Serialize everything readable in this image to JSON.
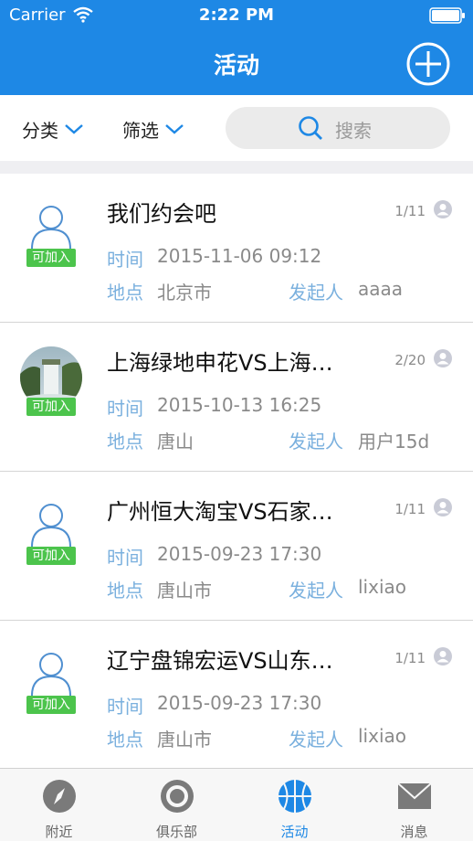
{
  "status_bar": {
    "carrier": "Carrier",
    "time": "2:22 PM"
  },
  "header": {
    "title": "活动"
  },
  "filter": {
    "category_label": "分类",
    "filter_label": "筛选",
    "search_placeholder": "搜索"
  },
  "activities": [
    {
      "title": "我们约会吧",
      "count": "1/11",
      "badge": "可加入",
      "time_label": "时间",
      "time": "2015-11-06 09:12",
      "place_label": "地点",
      "place": "北京市",
      "organizer_label": "发起人",
      "organizer": "aaaa",
      "has_photo": false
    },
    {
      "title": "上海绿地申花VS上海…",
      "count": "2/20",
      "badge": "可加入",
      "time_label": "时间",
      "time": "2015-10-13 16:25",
      "place_label": "地点",
      "place": "唐山",
      "organizer_label": "发起人",
      "organizer": "用户15d",
      "has_photo": true
    },
    {
      "title": "广州恒大淘宝VS石家…",
      "count": "1/11",
      "badge": "可加入",
      "time_label": "时间",
      "time": "2015-09-23 17:30",
      "place_label": "地点",
      "place": "唐山市",
      "organizer_label": "发起人",
      "organizer": "lixiao",
      "has_photo": false
    },
    {
      "title": "辽宁盘锦宏运VS山东…",
      "count": "1/11",
      "badge": "可加入",
      "time_label": "时间",
      "time": "2015-09-23 17:30",
      "place_label": "地点",
      "place": "唐山市",
      "organizer_label": "发起人",
      "organizer": "lixiao",
      "has_photo": false
    }
  ],
  "tabs": [
    {
      "label": "附近",
      "icon": "compass-icon",
      "active": false
    },
    {
      "label": "俱乐部",
      "icon": "target-icon",
      "active": false
    },
    {
      "label": "活动",
      "icon": "basketball-icon",
      "active": true
    },
    {
      "label": "消息",
      "icon": "mail-icon",
      "active": false
    }
  ],
  "colors": {
    "brand": "#1e88e5",
    "badge": "#4cc44c",
    "label": "#7ab0de"
  }
}
